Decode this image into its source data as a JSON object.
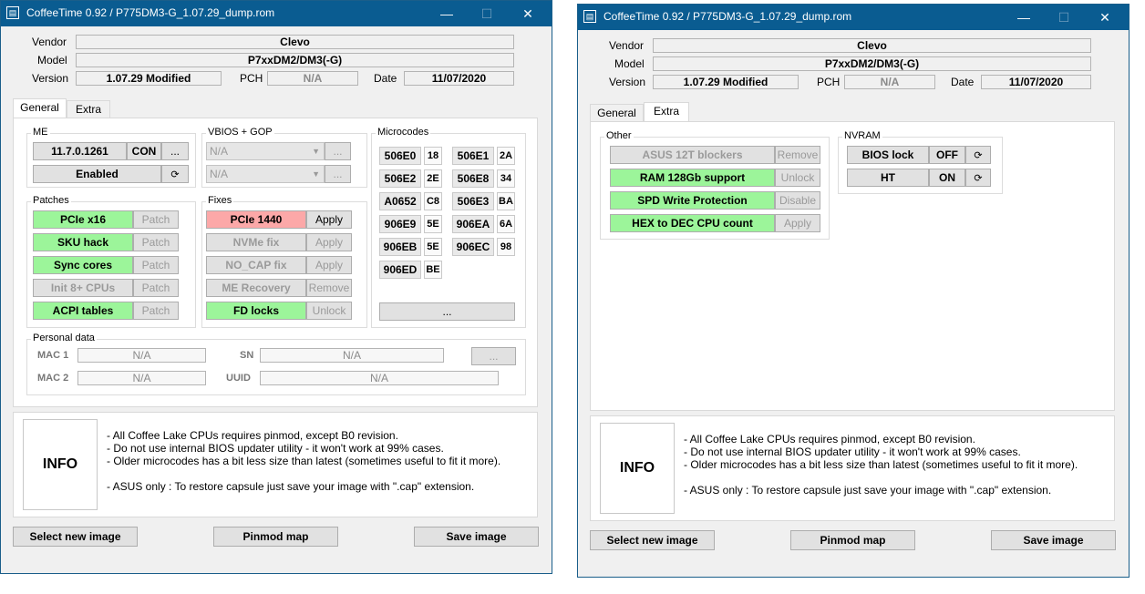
{
  "window_title": "CoffeeTime 0.92  /  P775DM3-G_1.07.29_dump.rom",
  "app_icon": "document-icon",
  "header": {
    "vendor_label": "Vendor",
    "vendor": "Clevo",
    "model_label": "Model",
    "model": "P7xxDM2/DM3(-G)",
    "version_label": "Version",
    "version": "1.07.29 Modified",
    "pch_label": "PCH",
    "pch": "N/A",
    "date_label": "Date",
    "date": "11/07/2020"
  },
  "tabs": {
    "general": "General",
    "extra": "Extra"
  },
  "general": {
    "me": {
      "title": "ME",
      "version": "11.7.0.1261",
      "type": "CON",
      "more": "...",
      "state": "Enabled",
      "refresh_icon": "refresh-icon"
    },
    "vbios": {
      "title": "VBIOS + GOP",
      "combo1": "N/A",
      "combo2": "N/A",
      "more1": "...",
      "more2": "..."
    },
    "microcodes": {
      "title": "Microcodes",
      "items": [
        {
          "cpuid": "506E0",
          "ver": "18"
        },
        {
          "cpuid": "506E1",
          "ver": "2A"
        },
        {
          "cpuid": "506E2",
          "ver": "2E"
        },
        {
          "cpuid": "506E8",
          "ver": "34"
        },
        {
          "cpuid": "A0652",
          "ver": "C8"
        },
        {
          "cpuid": "506E3",
          "ver": "BA"
        },
        {
          "cpuid": "906E9",
          "ver": "5E"
        },
        {
          "cpuid": "906EA",
          "ver": "6A"
        },
        {
          "cpuid": "906EB",
          "ver": "5E"
        },
        {
          "cpuid": "906EC",
          "ver": "98"
        },
        {
          "cpuid": "906ED",
          "ver": "BE"
        }
      ],
      "more": "..."
    },
    "patches": {
      "title": "Patches",
      "items": [
        {
          "name": "PCIe x16",
          "action": "Patch"
        },
        {
          "name": "SKU hack",
          "action": "Patch"
        },
        {
          "name": "Sync cores",
          "action": "Patch"
        },
        {
          "name": "Init 8+ CPUs",
          "action": "Patch"
        },
        {
          "name": "ACPI tables",
          "action": "Patch"
        }
      ]
    },
    "fixes": {
      "title": "Fixes",
      "items": [
        {
          "name": "PCIe 1440",
          "action": "Apply"
        },
        {
          "name": "NVMe fix",
          "action": "Apply"
        },
        {
          "name": "NO_CAP fix",
          "action": "Apply"
        },
        {
          "name": "ME Recovery",
          "action": "Remove"
        },
        {
          "name": "FD locks",
          "action": "Unlock"
        }
      ]
    },
    "personal": {
      "title": "Personal data",
      "mac1_label": "MAC 1",
      "mac1": "N/A",
      "mac2_label": "MAC 2",
      "mac2": "N/A",
      "sn_label": "SN",
      "sn": "N/A",
      "uuid_label": "UUID",
      "uuid": "N/A",
      "more": "..."
    }
  },
  "extra": {
    "other": {
      "title": "Other",
      "items": [
        {
          "name": "ASUS 12T blockers",
          "action": "Remove"
        },
        {
          "name": "RAM 128Gb support",
          "action": "Unlock"
        },
        {
          "name": "SPD Write Protection",
          "action": "Disable"
        },
        {
          "name": "HEX to DEC CPU count",
          "action": "Apply"
        }
      ]
    },
    "nvram": {
      "title": "NVRAM",
      "items": [
        {
          "name": "BIOS lock",
          "value": "OFF"
        },
        {
          "name": "HT",
          "value": "ON"
        }
      ]
    }
  },
  "info": {
    "title": "INFO",
    "line1": "- All Coffee Lake CPUs requires pinmod, except B0 revision.",
    "line2": "- Do not use internal BIOS updater utility - it won't work at 99% cases.",
    "line3": "- Older microcodes has a bit less size than latest (sometimes useful to fit it more).",
    "line4": "- ASUS only : To restore capsule just save your image with \".cap\" extension."
  },
  "buttons": {
    "select": "Select new image",
    "pinmod": "Pinmod map",
    "save": "Save image"
  },
  "window_controls": {
    "minimize": "—",
    "maximize": "☐",
    "close": "✕"
  },
  "colors": {
    "titlebar": "#0a5c91",
    "green": "#9cf59a",
    "red": "#fca8a8"
  }
}
